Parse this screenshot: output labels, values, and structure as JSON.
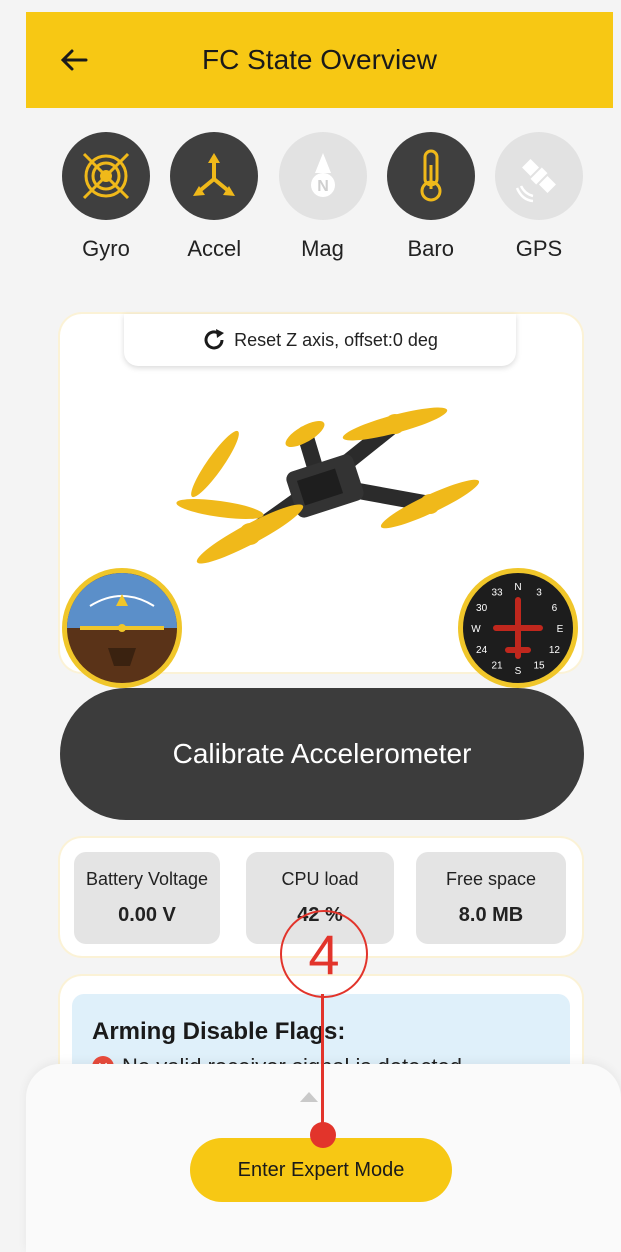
{
  "header": {
    "title": "FC State Overview"
  },
  "sensors": [
    {
      "label": "Gyro",
      "active": true
    },
    {
      "label": "Accel",
      "active": true
    },
    {
      "label": "Mag",
      "active": false
    },
    {
      "label": "Baro",
      "active": true
    },
    {
      "label": "GPS",
      "active": false
    }
  ],
  "drone_view": {
    "reset_label": "Reset Z axis, offset:0 deg",
    "compass_labels": [
      "N",
      "3",
      "6",
      "E",
      "12",
      "15",
      "S",
      "21",
      "24",
      "W",
      "30",
      "33"
    ]
  },
  "calibrate_label": "Calibrate Accelerometer",
  "stats": {
    "battery": {
      "label": "Battery Voltage",
      "value": "0.00 V"
    },
    "cpu": {
      "label": "CPU load",
      "value": "42 %"
    },
    "free": {
      "label": "Free space",
      "value": "8.0 MB"
    }
  },
  "arming": {
    "title": "Arming Disable Flags:",
    "flags": [
      "No valid receiver signal is detected"
    ]
  },
  "bottom_sheet": {
    "expert_label": "Enter Expert Mode"
  },
  "annotation": {
    "number": "4"
  },
  "colors": {
    "accent": "#f7c814",
    "dark": "#3f3f3f",
    "error": "#e2342b"
  }
}
